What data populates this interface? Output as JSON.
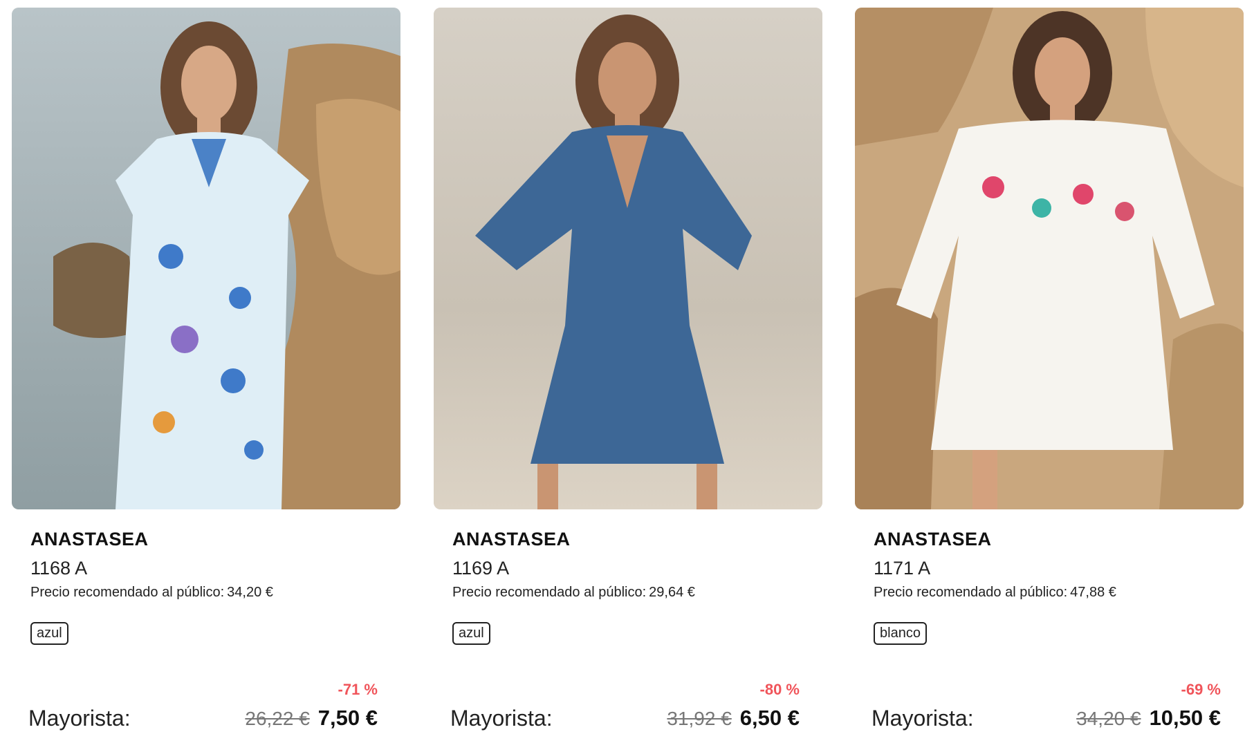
{
  "products": [
    {
      "brand": "ANASTASEA",
      "ref": "1168 A",
      "rrp_label": "Precio recomendado al público:",
      "rrp_value": "34,20 €",
      "color": "azul",
      "discount": "-71 %",
      "wholesale_label": "Mayorista:",
      "old_price": "26,22 €",
      "new_price": "7,50 €",
      "dress_color": "#dfeef6"
    },
    {
      "brand": "ANASTASEA",
      "ref": "1169 A",
      "rrp_label": "Precio recomendado al público:",
      "rrp_value": "29,64 €",
      "color": "azul",
      "discount": "-80 %",
      "wholesale_label": "Mayorista:",
      "old_price": "31,92 €",
      "new_price": "6,50 €",
      "dress_color": "#3d6796"
    },
    {
      "brand": "ANASTASEA",
      "ref": "1171 A",
      "rrp_label": "Precio recomendado al público:",
      "rrp_value": "47,88 €",
      "color": "blanco",
      "discount": "-69 %",
      "wholesale_label": "Mayorista:",
      "old_price": "34,20 €",
      "new_price": "10,50 €",
      "dress_color": "#f6f4ef"
    }
  ],
  "theme": {
    "discount_color": "#f0545a",
    "text_color": "#1a1a1a"
  }
}
